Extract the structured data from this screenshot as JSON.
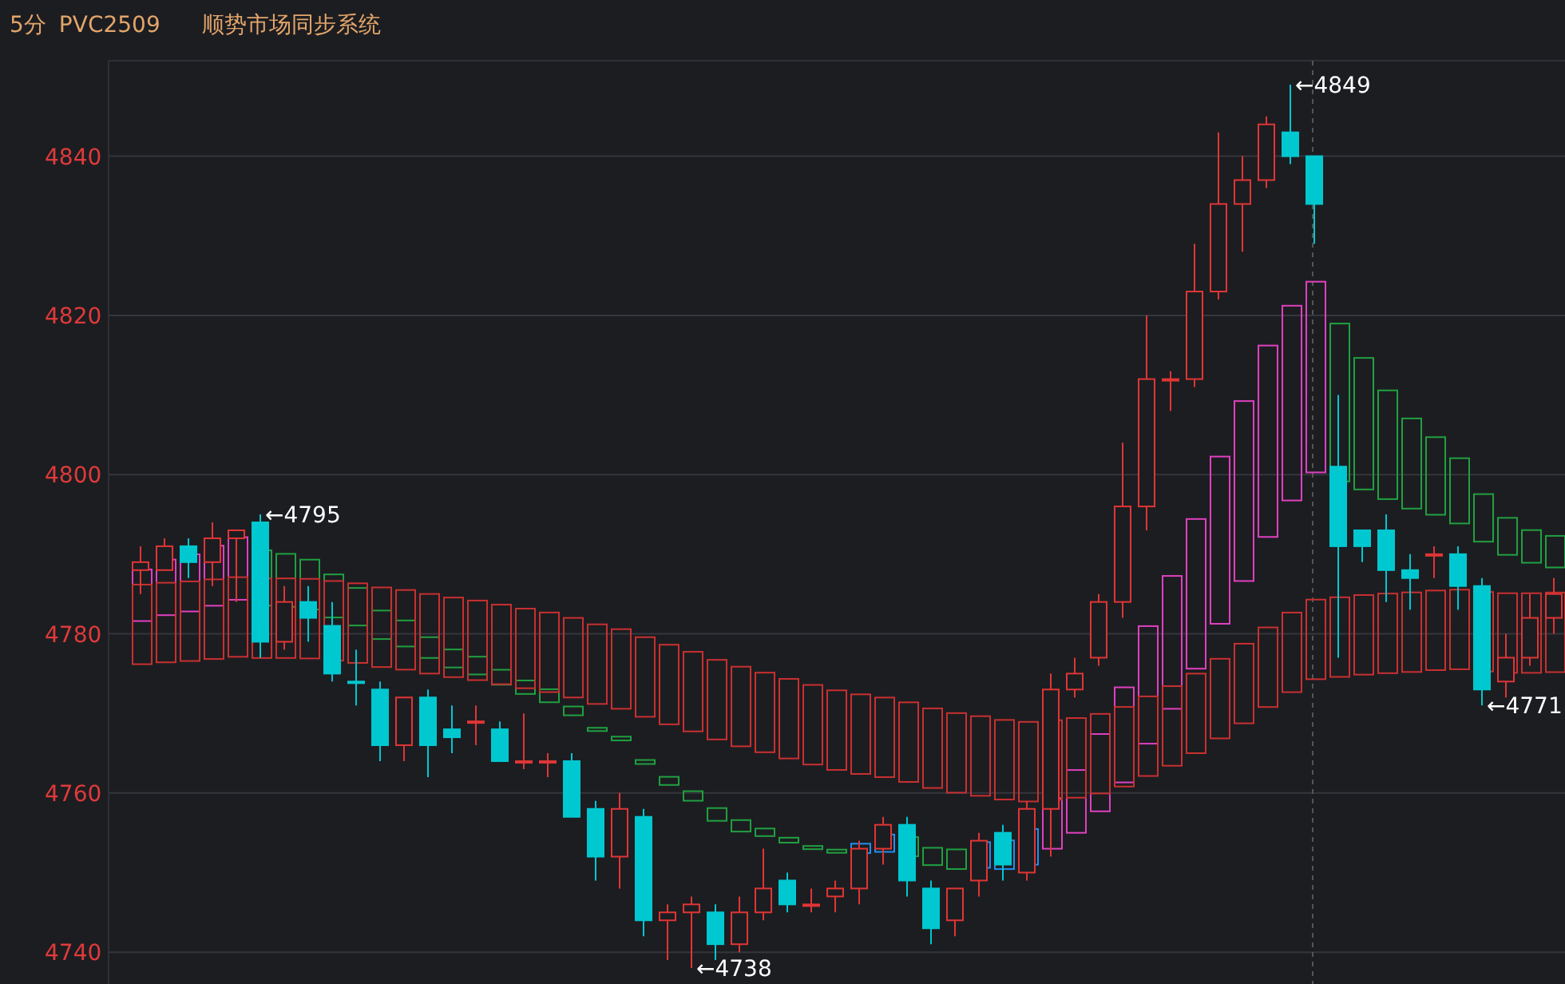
{
  "header": {
    "period": "5分",
    "symbol": "PVC2509",
    "title": "顺势市场同步系统"
  },
  "chart": {
    "chart_data": {
      "type": "candlestick",
      "ylim": [
        4736,
        4852
      ],
      "yticks": [
        4740,
        4760,
        4780,
        4800,
        4820,
        4840
      ],
      "grid": true,
      "ohlc": [
        [
          4788,
          4791,
          4785,
          4789
        ],
        [
          4788,
          4792,
          4788,
          4791
        ],
        [
          4791,
          4792,
          4787,
          4789
        ],
        [
          4789,
          4794,
          4786,
          4792
        ],
        [
          4792,
          4793,
          4784,
          4793
        ],
        [
          4794,
          4795,
          4777,
          4779
        ],
        [
          4779,
          4786,
          4778,
          4784
        ],
        [
          4784,
          4786,
          4779,
          4782
        ],
        [
          4781,
          4784,
          4774,
          4775
        ],
        [
          4774,
          4778,
          4771,
          4774
        ],
        [
          4773,
          4774,
          4764,
          4766
        ],
        [
          4766,
          4772,
          4764,
          4772
        ],
        [
          4772,
          4773,
          4762,
          4766
        ],
        [
          4768,
          4771,
          4765,
          4767
        ],
        [
          4769,
          4771,
          4766,
          4769
        ],
        [
          4768,
          4769,
          4764,
          4764
        ],
        [
          4764,
          4770,
          4763,
          4764
        ],
        [
          4764,
          4765,
          4762,
          4764
        ],
        [
          4764,
          4765,
          4757,
          4757
        ],
        [
          4758,
          4759,
          4749,
          4752
        ],
        [
          4752,
          4760,
          4748,
          4758
        ],
        [
          4757,
          4758,
          4742,
          4744
        ],
        [
          4744,
          4746,
          4739,
          4745
        ],
        [
          4745,
          4747,
          4738,
          4746
        ],
        [
          4745,
          4746,
          4739,
          4741
        ],
        [
          4741,
          4747,
          4740,
          4745
        ],
        [
          4745,
          4753,
          4744,
          4748
        ],
        [
          4749,
          4750,
          4745,
          4746
        ],
        [
          4746,
          4748,
          4745,
          4746
        ],
        [
          4747,
          4749,
          4745,
          4748
        ],
        [
          4748,
          4754,
          4746,
          4753
        ],
        [
          4753,
          4757,
          4751,
          4756
        ],
        [
          4756,
          4757,
          4747,
          4749
        ],
        [
          4748,
          4749,
          4741,
          4743
        ],
        [
          4744,
          4748,
          4742,
          4748
        ],
        [
          4749,
          4755,
          4747,
          4754
        ],
        [
          4755,
          4756,
          4749,
          4751
        ],
        [
          4750,
          4759,
          4749,
          4758
        ],
        [
          4758,
          4775,
          4752,
          4773
        ],
        [
          4773,
          4777,
          4772,
          4775
        ],
        [
          4777,
          4785,
          4776,
          4784
        ],
        [
          4784,
          4804,
          4782,
          4796
        ],
        [
          4796,
          4820,
          4793,
          4812
        ],
        [
          4812,
          4813,
          4808,
          4812
        ],
        [
          4812,
          4829,
          4811,
          4823
        ],
        [
          4823,
          4843,
          4822,
          4834
        ],
        [
          4834,
          4840,
          4828,
          4837
        ],
        [
          4837,
          4845,
          4836,
          4844
        ],
        [
          4843,
          4849,
          4839,
          4840
        ],
        [
          4840,
          4840,
          4829,
          4834
        ],
        [
          4801,
          4810,
          4777,
          4791
        ],
        [
          4793,
          4793,
          4789,
          4791
        ],
        [
          4793,
          4795,
          4784,
          4788
        ],
        [
          4788,
          4790,
          4783,
          4787
        ],
        [
          4790,
          4791,
          4787,
          4790
        ],
        [
          4790,
          4791,
          4783,
          4786
        ],
        [
          4786,
          4787,
          4771,
          4773
        ],
        [
          4774,
          4780,
          4772,
          4777
        ],
        [
          4777,
          4785,
          4776,
          4782
        ],
        [
          4782,
          4787,
          4780,
          4785
        ]
      ],
      "annotations": [
        {
          "text": "←4795"
        },
        {
          "text": "←4738"
        },
        {
          "text": "←4849"
        },
        {
          "text": "←4771"
        }
      ]
    }
  }
}
